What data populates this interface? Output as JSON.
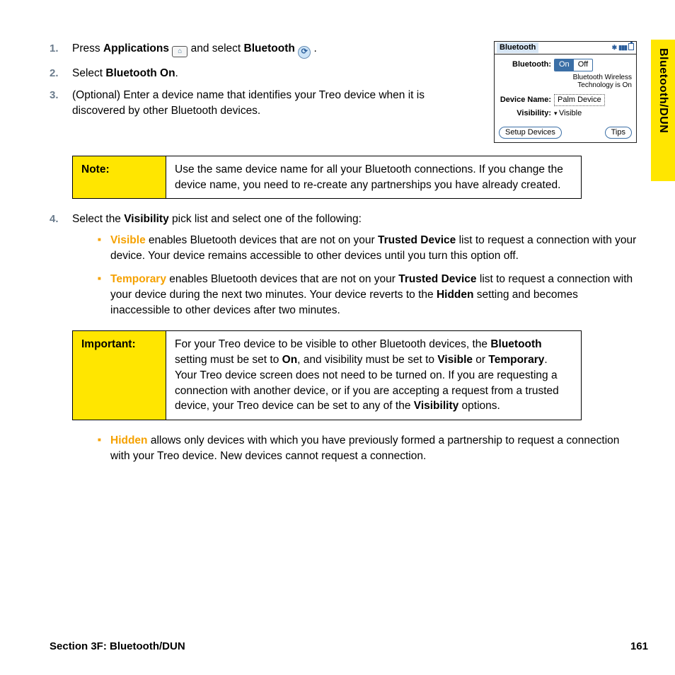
{
  "sideTab": "Bluetooth/DUN",
  "steps": {
    "s1": {
      "pre": "Press ",
      "b1": "Applications",
      "mid": " and select ",
      "b2": "Bluetooth",
      "end": " ."
    },
    "s2": {
      "pre": "Select ",
      "b1": "Bluetooth On",
      "end": "."
    },
    "s3": "(Optional) Enter a device name that identifies your Treo device when it is discovered by other Bluetooth devices.",
    "s4": {
      "pre": "Select the ",
      "b1": "Visibility",
      "post": " pick list and select one of the following:"
    }
  },
  "mock": {
    "title": "Bluetooth",
    "btLabel": "Bluetooth:",
    "on": "On",
    "off": "Off",
    "sub1": "Bluetooth Wireless",
    "sub2": "Technology is On",
    "dnLabel": "Device Name:",
    "dnValue": "Palm Device",
    "visLabel": "Visibility:",
    "visValue": "Visible",
    "setup": "Setup Devices",
    "tips": "Tips"
  },
  "note": {
    "label": "Note:",
    "text": "Use the same device name for all your Bluetooth connections. If you change the device name, you need to re-create any partnerships you have already created."
  },
  "sub1": {
    "b1": "Visible",
    "t1": " enables Bluetooth devices that are not on your ",
    "b2": "Trusted Device",
    "t2": " list to request a connection with your device. Your device remains accessible to other devices until you turn this option off."
  },
  "sub2": {
    "b1": "Temporary",
    "t1": " enables Bluetooth devices that are not on your ",
    "b2": "Trusted Device",
    "t2": " list to request a connection with your device during the next two minutes. Your device reverts to the ",
    "b3": "Hidden",
    "t3": " setting and becomes inaccessible to other devices after two minutes."
  },
  "important": {
    "label": "Important:",
    "t1": "For your Treo device to be visible to other Bluetooth devices, the ",
    "b1": "Bluetooth",
    "t2": " setting must be set to ",
    "b2": "On",
    "t3": ", and visibility must be set to ",
    "b3": "Visible",
    "t4": " or ",
    "b4": "Temporary",
    "t5": ". Your Treo device screen does not need to be turned on. If you are requesting a connection with another device, or if you are accepting a request from a trusted device, your Treo device can be set to any of the ",
    "b5": "Visibility",
    "t6": " options."
  },
  "sub3": {
    "b1": "Hidden",
    "t1": " allows only devices with which you have previously formed a partnership to request a connection with your Treo device. New devices cannot request a connection."
  },
  "footer": {
    "section": "Section 3F: Bluetooth/DUN",
    "page": "161"
  }
}
